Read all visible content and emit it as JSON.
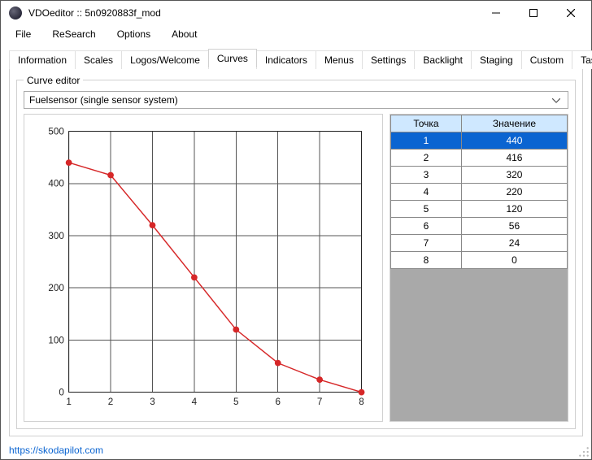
{
  "window": {
    "title": "VDOeditor :: 5n0920883f_mod"
  },
  "menu": {
    "file": "File",
    "research": "ReSearch",
    "options": "Options",
    "about": "About"
  },
  "tabs": {
    "information": "Information",
    "scales": "Scales",
    "logos": "Logos/Welcome",
    "curves": "Curves",
    "indicators": "Indicators",
    "menus": "Menus",
    "settings": "Settings",
    "backlight": "Backlight",
    "staging": "Staging",
    "custom": "Custom",
    "tasks": "Tasks"
  },
  "curve_editor": {
    "legend": "Curve editor",
    "dropdown_value": "Fuelsensor (single sensor system)"
  },
  "table": {
    "headers": {
      "point": "Точка",
      "value": "Значение"
    },
    "rows": [
      {
        "point": "1",
        "value": "440"
      },
      {
        "point": "2",
        "value": "416"
      },
      {
        "point": "3",
        "value": "320"
      },
      {
        "point": "4",
        "value": "220"
      },
      {
        "point": "5",
        "value": "120"
      },
      {
        "point": "6",
        "value": "56"
      },
      {
        "point": "7",
        "value": "24"
      },
      {
        "point": "8",
        "value": "0"
      }
    ]
  },
  "chart_data": {
    "type": "line",
    "x": [
      1,
      2,
      3,
      4,
      5,
      6,
      7,
      8
    ],
    "series": [
      {
        "name": "Fuelsensor",
        "values": [
          440,
          416,
          320,
          220,
          120,
          56,
          24,
          0
        ]
      }
    ],
    "xlabel": "",
    "ylabel": "",
    "xticks": [
      1,
      2,
      3,
      4,
      5,
      6,
      7,
      8
    ],
    "yticks": [
      0,
      100,
      200,
      300,
      400,
      500
    ],
    "xlim": [
      1,
      8
    ],
    "ylim": [
      0,
      500
    ],
    "grid": true
  },
  "status": {
    "link": "https://skodapilot.com"
  }
}
